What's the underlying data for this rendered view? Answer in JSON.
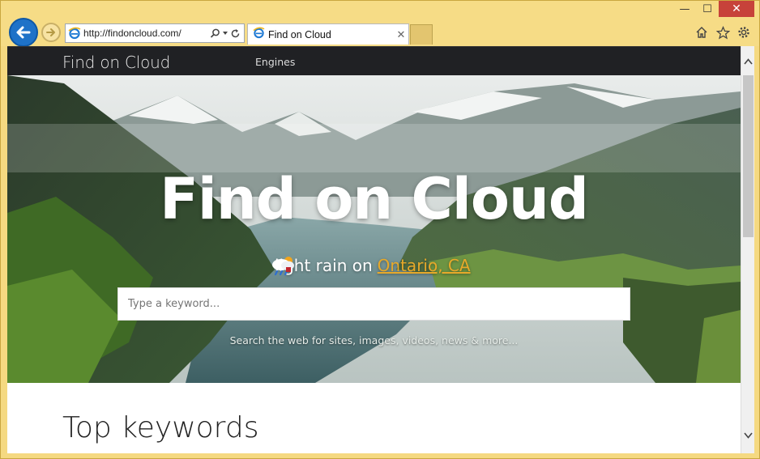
{
  "browser": {
    "address_url": "http://findoncloud.com/",
    "tab_title": "Find on Cloud",
    "caption": {
      "minimize": "—",
      "maximize": "☐",
      "close": "✕"
    }
  },
  "site": {
    "logo": "Find on Cloud",
    "nav_link": "Engines",
    "hero_title": "Find on Cloud",
    "weather_text": "light rain on",
    "weather_location": "Ontario, CA",
    "search_placeholder": "Type a keyword...",
    "search_hint": "Search the web for sites, images, videos, news & more...",
    "section_title": "Top keywords"
  },
  "colors": {
    "browser_chrome": "#f6dc86",
    "back_button": "#1e72c8",
    "nav_bg": "#202124",
    "link_orange": "#e7a92a"
  }
}
